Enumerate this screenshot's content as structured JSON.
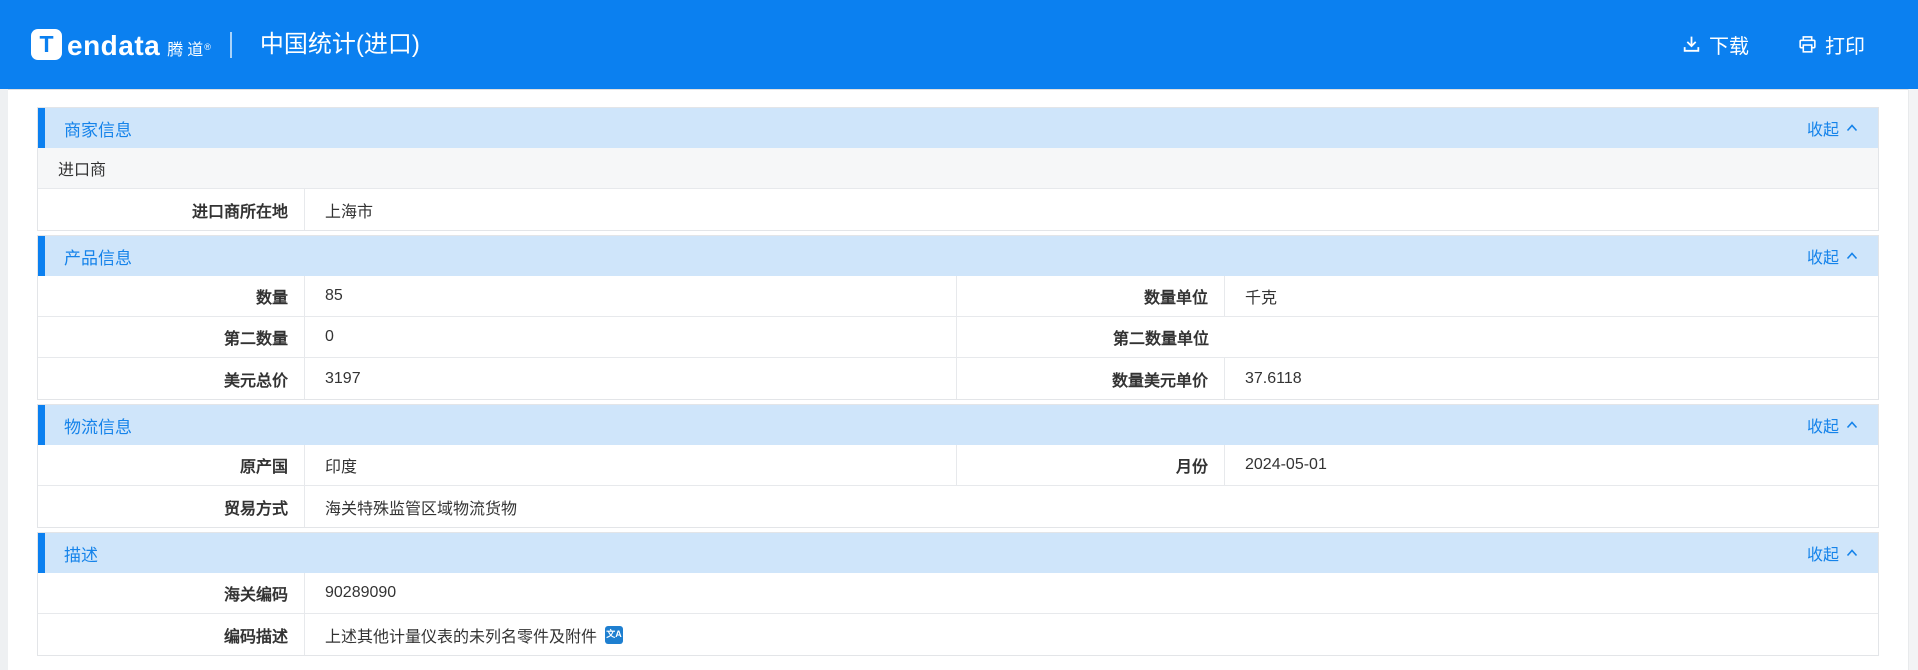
{
  "header": {
    "brand": {
      "logo_letter": "T",
      "wordmark": "endata",
      "brand_cn": "腾道",
      "reg": "®"
    },
    "title": "中国统计(进口)",
    "actions": {
      "download": "下载",
      "print": "打印"
    }
  },
  "collapse_label": "收起",
  "icons": {
    "translate": "文A"
  },
  "colors": {
    "header_bg": "#0b80f0",
    "section_header_bg": "#cfe5fa",
    "accent_bar": "#0b80f0",
    "link": "#1583ea",
    "row_border": "#e7e9ec"
  },
  "sections": [
    {
      "title": "商家信息",
      "rows": [
        {
          "type": "text",
          "text": "进口商"
        },
        {
          "type": "pair-full",
          "label": "进口商所在地",
          "value": "上海市"
        }
      ]
    },
    {
      "title": "产品信息",
      "rows": [
        {
          "type": "pair-double",
          "cells": [
            {
              "label": "数量",
              "value": "85"
            },
            {
              "label": "数量单位",
              "value": "千克"
            }
          ]
        },
        {
          "type": "pair-double",
          "cells": [
            {
              "label": "第二数量",
              "value": "0"
            },
            {
              "label": "第二数量单位",
              "value": ""
            }
          ]
        },
        {
          "type": "pair-double",
          "cells": [
            {
              "label": "美元总价",
              "value": "3197"
            },
            {
              "label": "数量美元单价",
              "value": "37.6118"
            }
          ]
        }
      ]
    },
    {
      "title": "物流信息",
      "rows": [
        {
          "type": "pair-double",
          "cells": [
            {
              "label": "原产国",
              "value": "印度"
            },
            {
              "label": "月份",
              "value": "2024-05-01"
            }
          ]
        },
        {
          "type": "pair-full",
          "label": "贸易方式",
          "value": "海关特殊监管区域物流货物"
        }
      ]
    },
    {
      "title": "描述",
      "rows": [
        {
          "type": "pair-full",
          "label": "海关编码",
          "value": "90289090"
        },
        {
          "type": "pair-full",
          "label": "编码描述",
          "value": "上述其他计量仪表的未列名零件及附件",
          "icon": "translate-icon"
        }
      ]
    }
  ]
}
